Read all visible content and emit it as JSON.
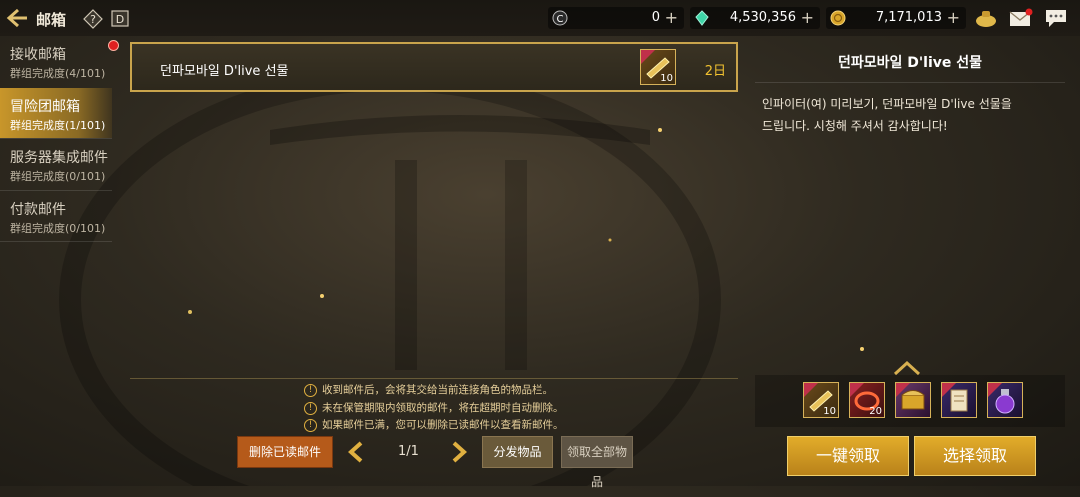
{
  "header": {
    "title": "邮箱",
    "currencies": [
      {
        "icon": "c-coin-icon",
        "value": "0"
      },
      {
        "icon": "green-crystal-icon",
        "value": "4,530,356"
      },
      {
        "icon": "gold-coin-icon",
        "value": "7,171,013"
      }
    ]
  },
  "sidebar": {
    "tabs": [
      {
        "label": "接收邮箱",
        "progress": "群组完成度(4/101)"
      },
      {
        "label": "冒险团邮箱",
        "progress": "群组完成度(1/101)"
      },
      {
        "label": "服务器集成邮件",
        "progress": "群组完成度(0/101)"
      },
      {
        "label": "付款邮件",
        "progress": "群组完成度(0/101)"
      }
    ]
  },
  "mail_list": [
    {
      "name": "던파모바일 D'live 선물",
      "item_qty": "10",
      "expires": "2日"
    }
  ],
  "detail": {
    "title": "던파모바일 D'live 선물",
    "body_lines": [
      "인파이터(여) 미리보기, 던파모바일 D'live 선물을",
      "드립니다. 시청해 주셔서 감사합니다!"
    ],
    "rewards": [
      {
        "icon": "gold-ticket-icon",
        "qty": "10"
      },
      {
        "icon": "red-ring-icon",
        "qty": "20"
      },
      {
        "icon": "treasure-chest-icon",
        "qty": ""
      },
      {
        "icon": "scroll-icon",
        "qty": ""
      },
      {
        "icon": "potion-icon",
        "qty": ""
      }
    ],
    "claim_all_label": "一键领取",
    "claim_select_label": "选择领取"
  },
  "notices": [
    "收到邮件后，会将其交给当前连接角色的物品栏。",
    "未在保管期限内领取的邮件，将在超期时自动删除。",
    "如果邮件已满，您可以删除已读邮件以查看新邮件。"
  ],
  "footer": {
    "delete_read_label": "删除已读邮件",
    "page": "1/1",
    "distribute_label": "分发物品",
    "receive_all_label": "领取全部物品"
  }
}
